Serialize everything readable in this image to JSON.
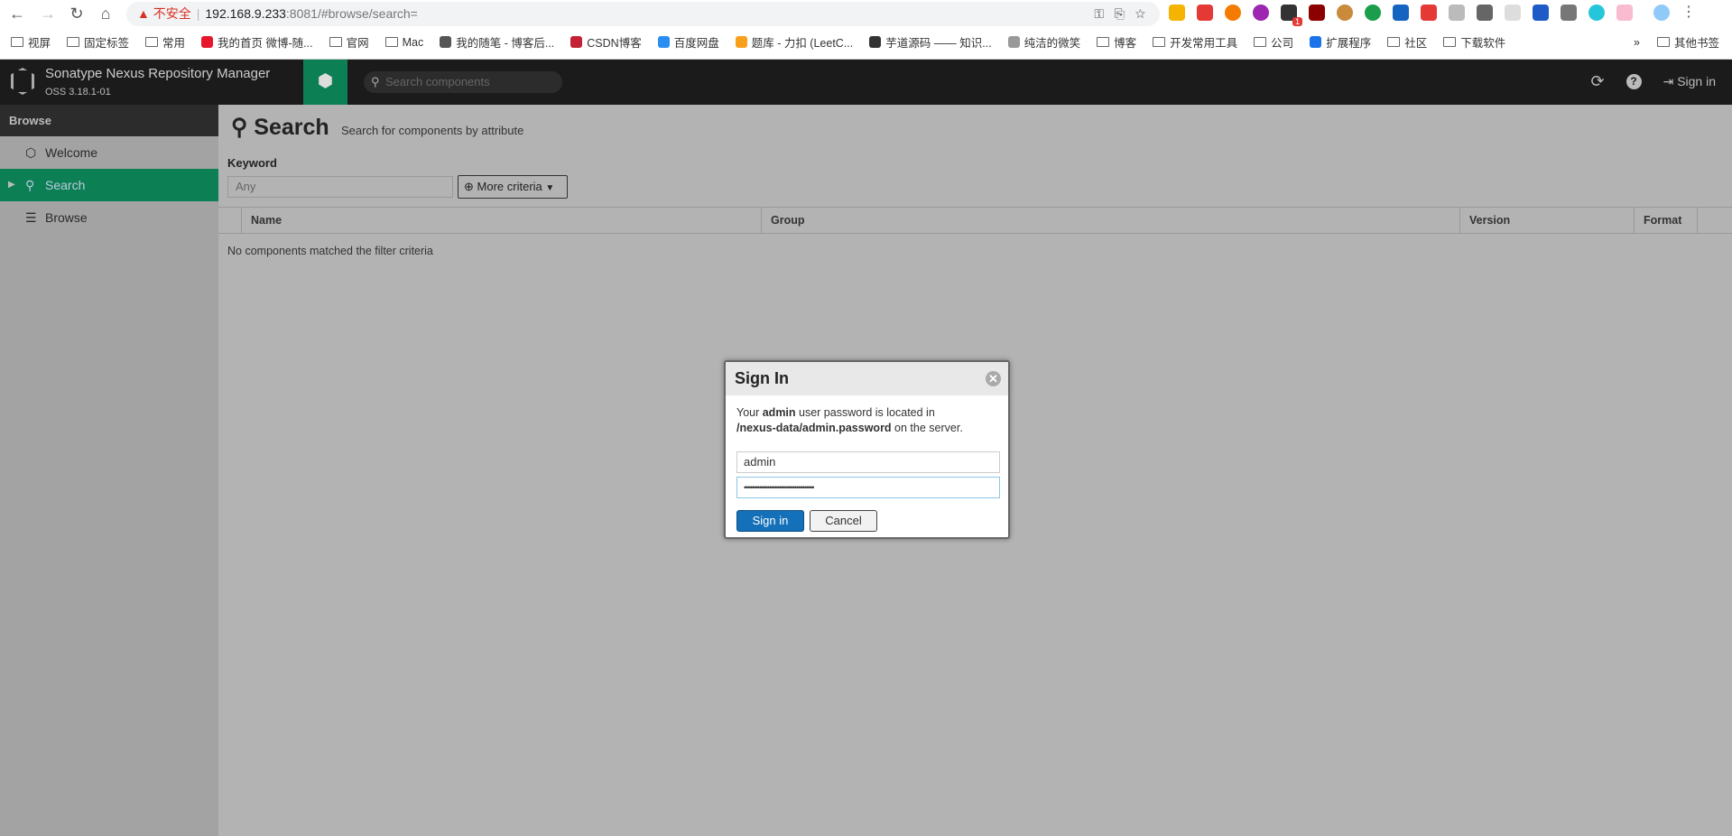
{
  "browser": {
    "security_label": "不安全",
    "url_host": "192.168.9.233",
    "url_rest": ":8081/#browse/search=",
    "ext_badge": "1",
    "bookmarks": [
      {
        "label": "视屏",
        "icon": "folder"
      },
      {
        "label": "固定标签",
        "icon": "folder"
      },
      {
        "label": "常用",
        "icon": "folder"
      },
      {
        "label": "我的首页 微博-随...",
        "icon": "weibo"
      },
      {
        "label": "官网",
        "icon": "folder"
      },
      {
        "label": "Mac",
        "icon": "folder"
      },
      {
        "label": "我的随笔 - 博客后...",
        "icon": "cnblogs"
      },
      {
        "label": "CSDN博客",
        "icon": "csdn"
      },
      {
        "label": "百度网盘",
        "icon": "baidu"
      },
      {
        "label": "题库 - 力扣 (LeetC...",
        "icon": "leetcode"
      },
      {
        "label": "芋道源码 —— 知识...",
        "icon": "globe"
      },
      {
        "label": "纯洁的微笑",
        "icon": "site"
      },
      {
        "label": "博客",
        "icon": "folder"
      },
      {
        "label": "开发常用工具",
        "icon": "folder"
      },
      {
        "label": "公司",
        "icon": "folder"
      },
      {
        "label": "扩展程序",
        "icon": "puzzle"
      },
      {
        "label": "社区",
        "icon": "folder"
      },
      {
        "label": "下载软件",
        "icon": "folder"
      }
    ],
    "overflow": "»",
    "other_bookmarks": "其他书签"
  },
  "header": {
    "brand": "Sonatype Nexus Repository Manager",
    "version": "OSS 3.18.1-01",
    "search_placeholder": "Search components",
    "sign_in": "Sign in"
  },
  "sidebar": {
    "title": "Browse",
    "items": [
      {
        "label": "Welcome"
      },
      {
        "label": "Search"
      },
      {
        "label": "Browse"
      }
    ]
  },
  "main": {
    "title": "Search",
    "subtitle": "Search for components by attribute",
    "keyword_label": "Keyword",
    "keyword_placeholder": "Any",
    "more_criteria": "More criteria",
    "columns": [
      "Name",
      "Group",
      "Version",
      "Format"
    ],
    "empty": "No components matched the filter criteria"
  },
  "dialog": {
    "title": "Sign In",
    "msg_1": "Your ",
    "msg_bold_1": "admin",
    "msg_2": " user password is located in",
    "msg_bold_2": "/nexus-data/admin.password",
    "msg_3": " on the server.",
    "username": "admin",
    "password_mask": "••••••••••••••••••••••••••••••••••••",
    "sign_in": "Sign in",
    "cancel": "Cancel"
  },
  "colors": {
    "accent": "#0d7f55",
    "primary_button": "#1470b8",
    "header": "#1b1b1b"
  }
}
